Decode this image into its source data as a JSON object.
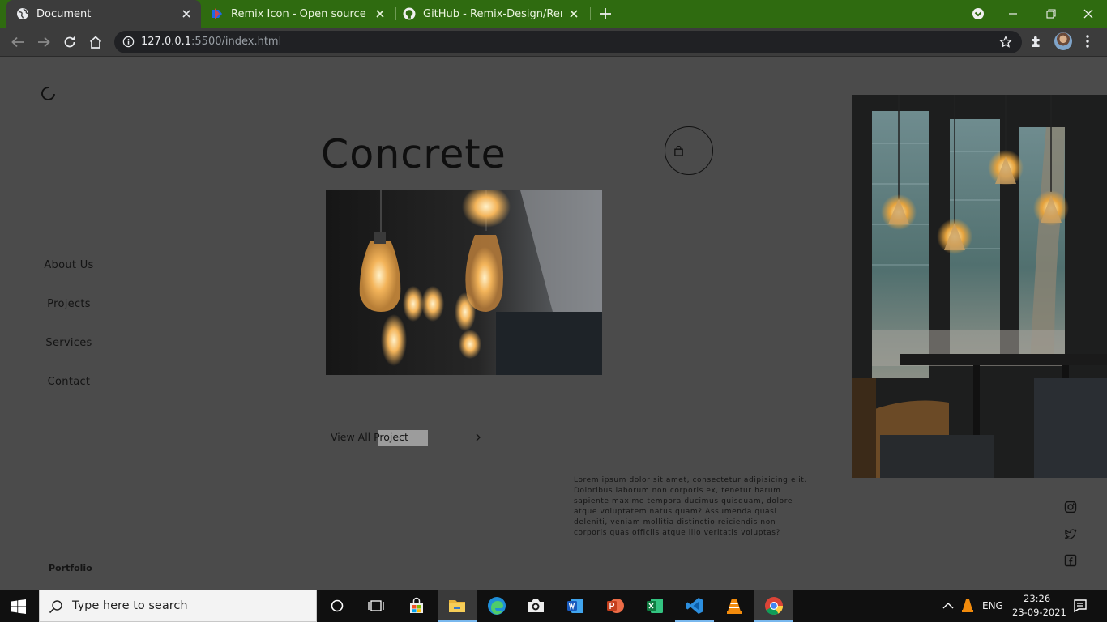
{
  "browser": {
    "tabs": [
      {
        "title": "Document",
        "icon": "globe-icon",
        "active": true
      },
      {
        "title": "Remix Icon - Open source icon lib",
        "icon": "remix-icon-logo",
        "active": false
      },
      {
        "title": "GitHub - Remix-Design/RemixIco",
        "icon": "github-icon",
        "active": false
      }
    ],
    "url_host": "127.0.0.1",
    "url_rest": ":5500/index.html"
  },
  "page": {
    "title": "Concrete",
    "nav": [
      "About Us",
      "Projects",
      "Services",
      "Contact"
    ],
    "cta": "View All Project",
    "body_text": "Lorem ipsum dolor sit amet, consectetur adipisicing elit. Doloribus laborum non corporis ex, tenetur harum sapiente maxime tempora ducimus quisquam, dolore atque voluptatem natus quam? Assumenda quasi deleniti, veniam mollitia distinctio reiciendis non corporis quas officiis atque illo veritatis voluptas?",
    "footer_brand": "Portfolio",
    "social": [
      "instagram-icon",
      "twitter-icon",
      "facebook-icon"
    ]
  },
  "taskbar": {
    "search_placeholder": "Type here to search",
    "apps": [
      "cortana-icon",
      "task-view-icon",
      "store-icon",
      "file-explorer-icon",
      "edge-icon",
      "camera-icon",
      "word-icon",
      "powerpoint-icon",
      "excel-icon",
      "vscode-icon",
      "vlc-icon",
      "chrome-icon"
    ],
    "language": "ENG",
    "time": "23:26",
    "date": "23-09-2021"
  },
  "colors": {
    "tab_strip": "#2f6b10",
    "page_background": "#4b4b4b",
    "text": "#141414"
  }
}
